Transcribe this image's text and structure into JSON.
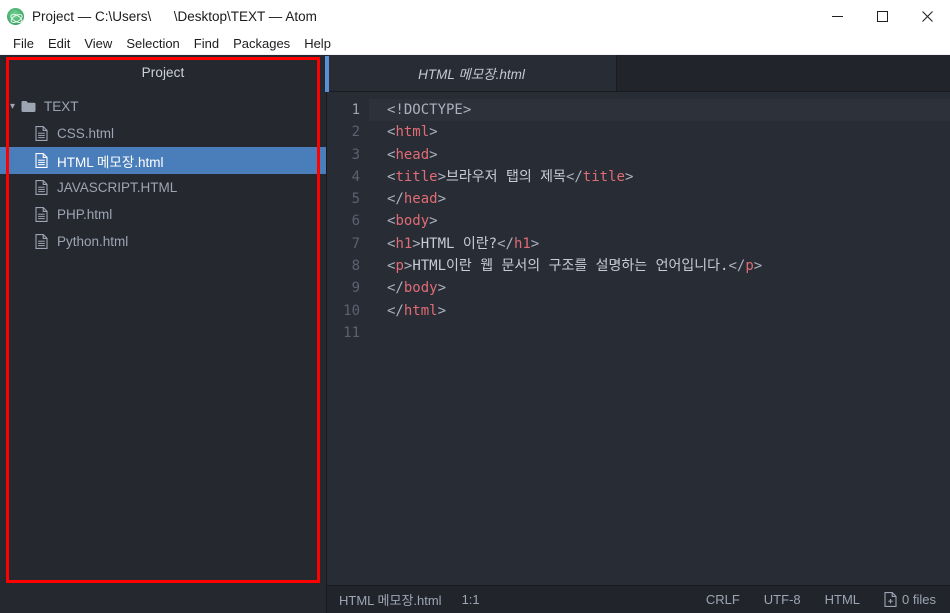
{
  "window": {
    "title": "Project — C:\\Users\\      \\Desktop\\TEXT — Atom",
    "logo_icon": "atom-logo-icon",
    "controls": {
      "minimize": "minimize-icon",
      "maximize": "maximize-icon",
      "close": "close-icon"
    }
  },
  "menubar": {
    "items": [
      {
        "label": "File"
      },
      {
        "label": "Edit"
      },
      {
        "label": "View"
      },
      {
        "label": "Selection"
      },
      {
        "label": "Find"
      },
      {
        "label": "Packages"
      },
      {
        "label": "Help"
      }
    ]
  },
  "sidebar": {
    "header": "Project",
    "root": {
      "label": "TEXT",
      "icon": "folder-icon",
      "chevron": "chevron-down-icon",
      "expanded": true
    },
    "files": [
      {
        "label": "CSS.html",
        "icon": "file-icon",
        "selected": false
      },
      {
        "label": "HTML 메모장.html",
        "icon": "file-icon",
        "selected": true
      },
      {
        "label": "JAVASCRIPT.HTML",
        "icon": "file-icon",
        "selected": false
      },
      {
        "label": "PHP.html",
        "icon": "file-icon",
        "selected": false
      },
      {
        "label": "Python.html",
        "icon": "file-icon",
        "selected": false
      }
    ]
  },
  "annotations": {
    "red_box_color": "#ff0000",
    "blue_strip_color": "#5a8fd6"
  },
  "editor": {
    "tab": {
      "label": "HTML 메모장.html",
      "italic": true
    },
    "line_numbers": [
      "1",
      "2",
      "3",
      "4",
      "5",
      "6",
      "7",
      "8",
      "9",
      "10",
      "11"
    ],
    "active_line": 1,
    "lines": [
      {
        "n": 1,
        "tokens": [
          {
            "t": "punct",
            "v": "<!DOCTYPE>"
          }
        ]
      },
      {
        "n": 2,
        "tokens": [
          {
            "t": "punct",
            "v": "<"
          },
          {
            "t": "tg",
            "v": "html"
          },
          {
            "t": "punct",
            "v": ">"
          }
        ]
      },
      {
        "n": 3,
        "tokens": [
          {
            "t": "punct",
            "v": "<"
          },
          {
            "t": "tg",
            "v": "head"
          },
          {
            "t": "punct",
            "v": ">"
          }
        ]
      },
      {
        "n": 4,
        "tokens": [
          {
            "t": "punct",
            "v": "<"
          },
          {
            "t": "tg",
            "v": "title"
          },
          {
            "t": "punct",
            "v": ">"
          },
          {
            "t": "txt",
            "v": "브라우저 탭의 제목"
          },
          {
            "t": "punct",
            "v": "</"
          },
          {
            "t": "tg",
            "v": "title"
          },
          {
            "t": "punct",
            "v": ">"
          }
        ]
      },
      {
        "n": 5,
        "tokens": [
          {
            "t": "punct",
            "v": "</"
          },
          {
            "t": "tg",
            "v": "head"
          },
          {
            "t": "punct",
            "v": ">"
          }
        ]
      },
      {
        "n": 6,
        "tokens": [
          {
            "t": "punct",
            "v": "<"
          },
          {
            "t": "tg",
            "v": "body"
          },
          {
            "t": "punct",
            "v": ">"
          }
        ]
      },
      {
        "n": 7,
        "tokens": [
          {
            "t": "punct",
            "v": "<"
          },
          {
            "t": "tg",
            "v": "h1"
          },
          {
            "t": "punct",
            "v": ">"
          },
          {
            "t": "txt",
            "v": "HTML 이란?"
          },
          {
            "t": "punct",
            "v": "</"
          },
          {
            "t": "tg",
            "v": "h1"
          },
          {
            "t": "punct",
            "v": ">"
          }
        ]
      },
      {
        "n": 8,
        "tokens": [
          {
            "t": "punct",
            "v": "<"
          },
          {
            "t": "tg",
            "v": "p"
          },
          {
            "t": "punct",
            "v": ">"
          },
          {
            "t": "txt",
            "v": "HTML이란 웹 문서의 구조를 설명하는 언어입니다."
          },
          {
            "t": "punct",
            "v": "</"
          },
          {
            "t": "tg",
            "v": "p"
          },
          {
            "t": "punct",
            "v": ">"
          }
        ]
      },
      {
        "n": 9,
        "tokens": [
          {
            "t": "punct",
            "v": "</"
          },
          {
            "t": "tg",
            "v": "body"
          },
          {
            "t": "punct",
            "v": ">"
          }
        ]
      },
      {
        "n": 10,
        "tokens": [
          {
            "t": "punct",
            "v": "</"
          },
          {
            "t": "tg",
            "v": "html"
          },
          {
            "t": "punct",
            "v": ">"
          }
        ]
      },
      {
        "n": 11,
        "tokens": []
      }
    ],
    "syntax_colors": {
      "tag_name": "#e06c75",
      "punctuation": "#abb2bf",
      "text": "#c8ccd4",
      "background": "#282c34",
      "active_line_bg": "#2c313a"
    }
  },
  "statusbar": {
    "filename": "HTML 메모장.html",
    "cursor": "1:1",
    "line_ending": "CRLF",
    "encoding": "UTF-8",
    "grammar": "HTML",
    "git_icon": "file-diff-icon",
    "git_files": "0 files"
  }
}
